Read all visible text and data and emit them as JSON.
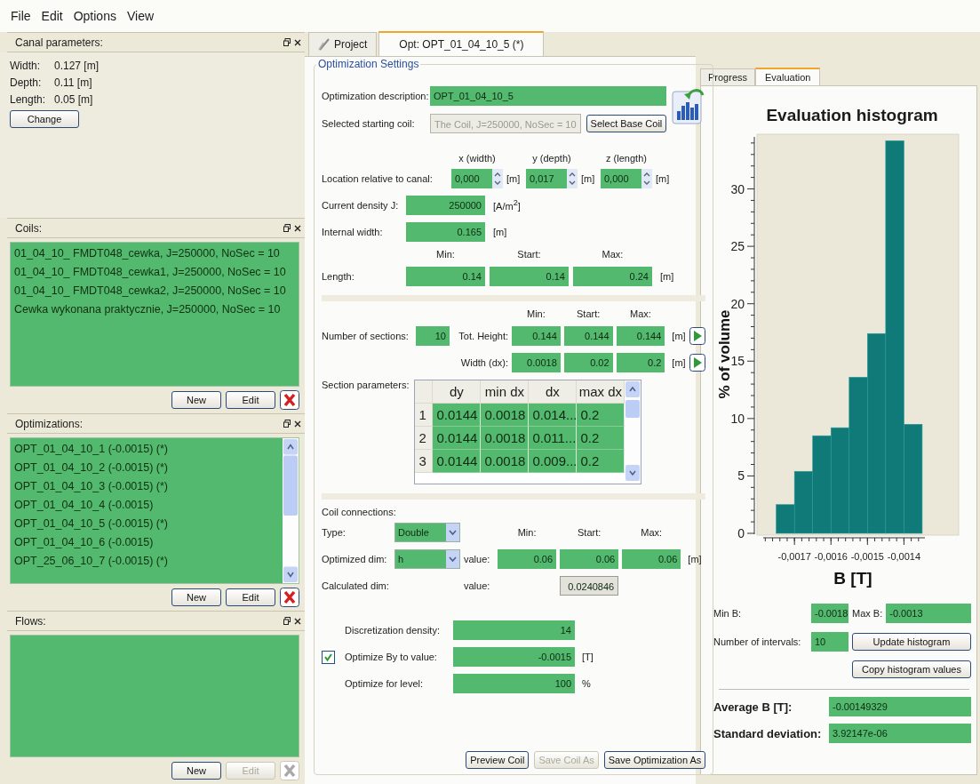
{
  "menu": [
    "File",
    "Edit",
    "Options",
    "View"
  ],
  "docks": [
    {
      "kind": "params",
      "title": "Canal parameters:",
      "params": [
        {
          "label": "Width:",
          "value": "0.127 [m]"
        },
        {
          "label": "Depth:",
          "value": "0.11 [m]"
        },
        {
          "label": "Length:",
          "value": "0.05 [m]"
        }
      ],
      "button": "Change"
    },
    {
      "kind": "list",
      "title": "Coils:",
      "items": [
        "01_04_10_ FMDT048_cewka, J=250000, NoSec = 10",
        "01_04_10_ FMDT048_cewka1, J=250000, NoSec = 10",
        "01_04_10_ FMDT048_cewka2, J=250000, NoSec = 10",
        "Cewka wykonana praktycznie, J=250000, NoSec = 10"
      ],
      "buttons": [
        {
          "label": "New",
          "disabled": false
        },
        {
          "label": "Edit",
          "disabled": false
        }
      ],
      "delete_disabled": false
    },
    {
      "kind": "list",
      "title": "Optimizations:",
      "items": [
        "OPT_01_04_10_1 (-0.0015) (*)",
        "OPT_01_04_10_2 (-0.0015) (*)",
        "OPT_01_04_10_3 (-0.0015) (*)",
        "OPT_01_04_10_4 (-0.0015)",
        "OPT_01_04_10_5 (-0.0015) (*)",
        "OPT_01_04_10_6 (-0.0015)",
        "OPT_25_06_10_7 (-0.0015) (*)"
      ],
      "scrollbar": true,
      "buttons": [
        {
          "label": "New",
          "disabled": false
        },
        {
          "label": "Edit",
          "disabled": false
        }
      ],
      "delete_disabled": false
    },
    {
      "kind": "list",
      "title": "Flows:",
      "buttons": [
        {
          "label": "New",
          "disabled": false
        },
        {
          "label": "Edit",
          "disabled": true
        }
      ],
      "delete_disabled": true
    }
  ],
  "tabs": [
    {
      "kind": "project",
      "label": "Project",
      "selected": false
    },
    {
      "kind": "optimization",
      "label": "Opt: OPT_01_04_10_5 (*)",
      "selected": true
    }
  ],
  "optimization": {
    "group_title": "Optimization Settings",
    "description": {
      "label": "Optimization description:",
      "value": "OPT_01_04_10_5"
    },
    "starting_coil": {
      "label": "Selected starting coil:",
      "value": "The Coil, J=250000, NoSec = 10",
      "button": "Select Base Coil"
    },
    "location": {
      "label": "Location relative to canal:",
      "columns": [
        "x (width)",
        "y (depth)",
        "z (length)"
      ],
      "values": [
        "0,000",
        "0,017",
        "0,000"
      ],
      "units": [
        "[m]",
        "[m]",
        "[m]"
      ]
    },
    "current_density": {
      "label": "Current density J:",
      "value": "250000",
      "unit": "[A/m$^{2}$]"
    },
    "internal_width": {
      "label": "Internal width:",
      "value": "0.165",
      "unit": "[m]"
    },
    "length": {
      "headers": [
        "Min:",
        "Start:",
        "Max:"
      ],
      "label": "Length:",
      "values": [
        "0.14",
        "0.14",
        "0.24"
      ],
      "unit": "[m]"
    },
    "sections": {
      "headers": [
        "Min:",
        "Start:",
        "Max:"
      ],
      "count_label": "Number of sections:",
      "count": "10",
      "rows": [
        {
          "label": "Tot. Height:",
          "values": [
            "0.144",
            "0.144",
            "0.144"
          ],
          "unit": "[m]"
        },
        {
          "label": "Width (dx):",
          "values": [
            "0.0018",
            "0.02",
            "0.2"
          ],
          "unit": "[m]"
        }
      ]
    },
    "section_table": {
      "label": "Section parameters:",
      "columns": [
        "dy",
        "min dx",
        "dx",
        "max dx"
      ],
      "rows": [
        {
          "index": "1",
          "cells": [
            "0.0144",
            "0.0018",
            "0.014...",
            "0.2"
          ]
        },
        {
          "index": "2",
          "cells": [
            "0.0144",
            "0.0018",
            "0.011...",
            "0.2"
          ]
        },
        {
          "index": "3",
          "cells": [
            "0.0144",
            "0.0018",
            "0.009...",
            "0.2"
          ]
        }
      ]
    },
    "coil_connections": {
      "title": "Coil connections:",
      "type": {
        "label": "Type:",
        "value": "Double"
      },
      "headers": [
        "Min:",
        "Start:",
        "Max:"
      ],
      "optimized": {
        "label": "Optimized dim:",
        "value": "h",
        "value_label": "value:",
        "values": [
          "0.06",
          "0.06",
          "0.06"
        ],
        "unit": "[m]"
      },
      "calculated": {
        "label": "Calculated dim:",
        "value_label": "value:",
        "value": "0.0240846"
      }
    },
    "discretization": {
      "label": "Discretization density:",
      "value": "14"
    },
    "optimize_by": {
      "checked": true,
      "label": "Optimize By to value:",
      "value": "-0.0015",
      "unit": "[T]"
    },
    "level": {
      "label": "Optimize for level:",
      "value": "100",
      "unit": "%"
    },
    "buttons": [
      {
        "label": "Preview Coil",
        "disabled": false
      },
      {
        "label": "Save Coil As",
        "disabled": true
      },
      {
        "label": "Save Optimization As",
        "disabled": false
      }
    ]
  },
  "side_tabs": [
    {
      "label": "Progress",
      "selected": false
    },
    {
      "label": "Evaluation",
      "selected": true
    }
  ],
  "evaluation": {
    "chart_data": {
      "type": "bar",
      "title": "Evaluation histogram",
      "xlabel": "B [T]",
      "ylabel": "% of volume",
      "x": [
        -0.001725,
        -0.001675,
        -0.001625,
        -0.001575,
        -0.001525,
        -0.001475,
        -0.001425,
        -0.001375
      ],
      "values": [
        2.5,
        5.4,
        8.5,
        9.2,
        13.6,
        17.4,
        34.2,
        9.5
      ],
      "xlim": [
        -0.00181,
        -0.00125
      ],
      "ylim": [
        0,
        34.3
      ],
      "xticks": [
        {
          "value": -0.0017,
          "label": "-0,0017"
        },
        {
          "value": -0.0016,
          "label": "-0,0016"
        },
        {
          "value": -0.0015,
          "label": "-0,0015"
        },
        {
          "value": -0.0014,
          "label": "-0,0014"
        }
      ],
      "yticks": [
        0,
        5,
        10,
        15,
        20,
        25,
        30
      ]
    },
    "min_b": {
      "label": "Min B:",
      "value": "-0.0018"
    },
    "max_b": {
      "label": "Max B:",
      "value": "-0.0013"
    },
    "intervals": {
      "label": "Number of intervals:",
      "value": "10"
    },
    "buttons": [
      "Update histogram",
      "Copy histogram values"
    ],
    "average": {
      "label": "Average B [T]:",
      "value": "-0.00149329"
    },
    "std": {
      "label": "Standard deviation:",
      "value": "3.92147e-06"
    }
  }
}
